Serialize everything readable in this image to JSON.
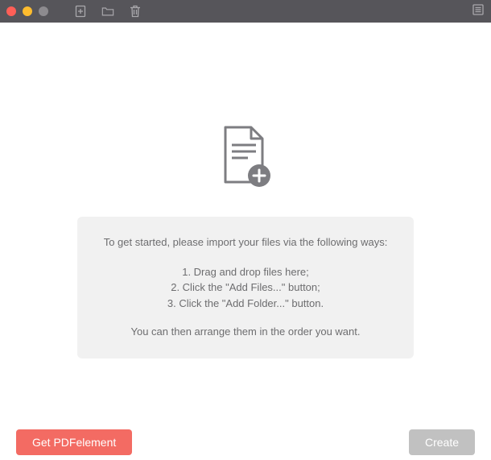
{
  "instructions": {
    "intro": "To get started, please import your files via the following ways:",
    "step1": "1. Drag and drop files here;",
    "step2": "2. Click the \"Add Files...\" button;",
    "step3": "3. Click the \"Add Folder...\" button.",
    "outro": "You can then arrange them in the order you want."
  },
  "footer": {
    "get_button": "Get PDFelement",
    "create_button": "Create"
  }
}
